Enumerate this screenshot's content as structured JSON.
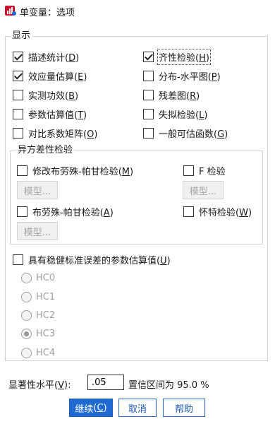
{
  "window": {
    "title": "单变量：选项"
  },
  "display_group": {
    "legend": "显示",
    "options": [
      {
        "text": "描述统计",
        "key": "D",
        "checked": true
      },
      {
        "text": "齐性检验",
        "key": "H",
        "checked": true
      },
      {
        "text": "效应量估算",
        "key": "E",
        "checked": true
      },
      {
        "text": "分布-水平图",
        "key": "P",
        "checked": false
      },
      {
        "text": "实测功效",
        "key": "B",
        "checked": false
      },
      {
        "text": "残差图",
        "key": "R",
        "checked": false
      },
      {
        "text": "参数估算值",
        "key": "T",
        "checked": false
      },
      {
        "text": "失拟检验",
        "key": "L",
        "checked": false
      },
      {
        "text": "对比系数矩阵",
        "key": "O",
        "checked": false
      },
      {
        "text": "一般可估函数",
        "key": "G",
        "checked": false
      }
    ]
  },
  "hetero_group": {
    "legend": "异方差性检验",
    "options": [
      {
        "text": "修改布劳殊-帕甘检验",
        "key": "M",
        "checked": false
      },
      {
        "text": "F 检验",
        "key": "",
        "checked": false
      },
      {
        "text": "布劳殊-帕甘检验",
        "key": "A",
        "checked": false
      },
      {
        "text": "怀特检验",
        "key": "W",
        "checked": false
      }
    ],
    "model_button_label": "模型..."
  },
  "robust": {
    "text": "具有稳健标准误差的参数估算值",
    "key": "U",
    "checked": false,
    "radios": [
      {
        "label": "HC0",
        "selected": false
      },
      {
        "label": "HC1",
        "selected": false
      },
      {
        "label": "HC2",
        "selected": false
      },
      {
        "label": "HC3",
        "selected": true
      },
      {
        "label": "HC4",
        "selected": false
      }
    ]
  },
  "significance": {
    "label": "显著性水平",
    "key": "V",
    "value": ".05",
    "ci_text": "置信区间为 95.0 %"
  },
  "buttons": {
    "continue": {
      "text": "继续",
      "key": "C"
    },
    "cancel": "取消",
    "help": "帮助"
  },
  "colors": {
    "primary": "#1e69d2",
    "disabled_text": "#a8a8a8"
  }
}
